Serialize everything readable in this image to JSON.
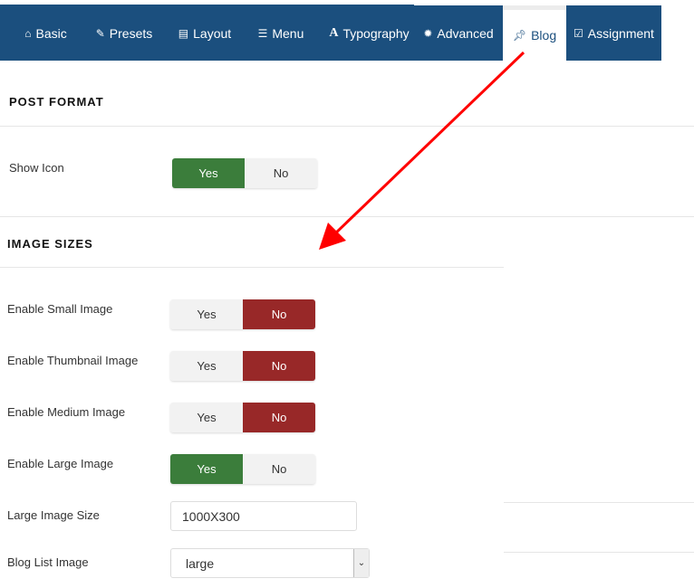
{
  "tabs": [
    {
      "label": "Basic",
      "icon": "home-icon"
    },
    {
      "label": "Presets",
      "icon": "brush-icon"
    },
    {
      "label": "Layout",
      "icon": "layout-icon"
    },
    {
      "label": "Menu",
      "icon": "list-icon"
    },
    {
      "label": "Typography",
      "icon": "font-icon"
    },
    {
      "label": "Advanced",
      "icon": "gear-icon"
    },
    {
      "label": "Blog",
      "icon": "pin-icon",
      "active": true
    },
    {
      "label": "Assignment",
      "icon": "checkbox-icon"
    }
  ],
  "sections": {
    "post_format": "POST FORMAT",
    "image_sizes": "IMAGE SIZES"
  },
  "fields": {
    "show_icon": {
      "label": "Show Icon",
      "value": "Yes"
    },
    "small": {
      "label": "Enable Small Image",
      "value": "No"
    },
    "thumb": {
      "label": "Enable Thumbnail Image",
      "value": "No"
    },
    "medium": {
      "label": "Enable Medium Image",
      "value": "No"
    },
    "large": {
      "label": "Enable Large Image",
      "value": "Yes"
    },
    "large_size": {
      "label": "Large Image Size",
      "value": "1000X300"
    },
    "blog_list": {
      "label": "Blog List Image",
      "value": "large"
    }
  },
  "toggle": {
    "yes": "Yes",
    "no": "No"
  },
  "colors": {
    "nav": "#1b4f7e",
    "yes": "#3b7d3b",
    "no": "#982828",
    "arrow": "#ff0000"
  }
}
